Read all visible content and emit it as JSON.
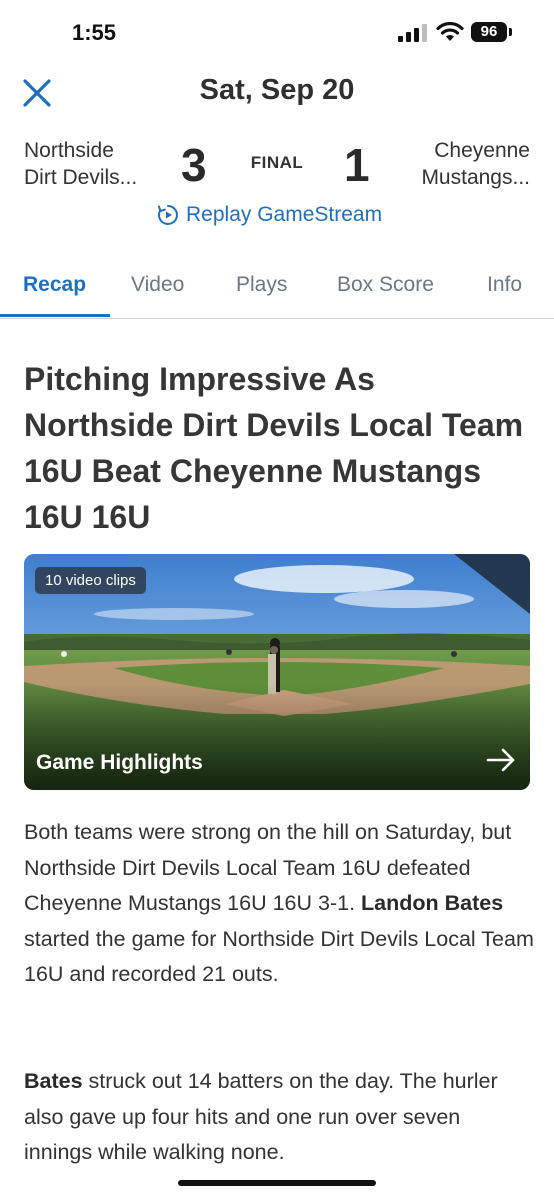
{
  "status_bar": {
    "time": "1:55",
    "battery": "96"
  },
  "header": {
    "date": "Sat, Sep 20"
  },
  "scoreboard": {
    "home_team_line1": "Northside",
    "home_team_line2": "Dirt Devils...",
    "home_score": "3",
    "status": "FINAL",
    "away_score": "1",
    "away_team_line1": "Cheyenne",
    "away_team_line2": "Mustangs...",
    "replay_label": "Replay GameStream"
  },
  "tabs": [
    {
      "label": "Recap",
      "active": true
    },
    {
      "label": "Video"
    },
    {
      "label": "Plays"
    },
    {
      "label": "Box Score"
    },
    {
      "label": "Info"
    }
  ],
  "article": {
    "headline": "Pitching Impressive As Northside Dirt Devils Local Team 16U Beat Cheyenne Mustangs 16U 16U",
    "highlights": {
      "clips_badge": "10 video clips",
      "title": "Game Highlights"
    },
    "p1_a": "Both teams were strong on the hill on Saturday, but Northside Dirt Devils Local Team 16U defeated Cheyenne Mustangs 16U 16U 3-1. ",
    "p1_bold": "Landon Bates",
    "p1_b": " started the game for Northside Dirt Devils Local Team 16U and recorded 21 outs.",
    "p2_bold": "Bates",
    "p2_a": " struck out 14 batters on the day. The hurler also gave up four hits and one run over seven innings while walking none."
  },
  "colors": {
    "accent": "#1e6fc2",
    "tab_inactive": "#6a7785",
    "text": "#333333"
  }
}
